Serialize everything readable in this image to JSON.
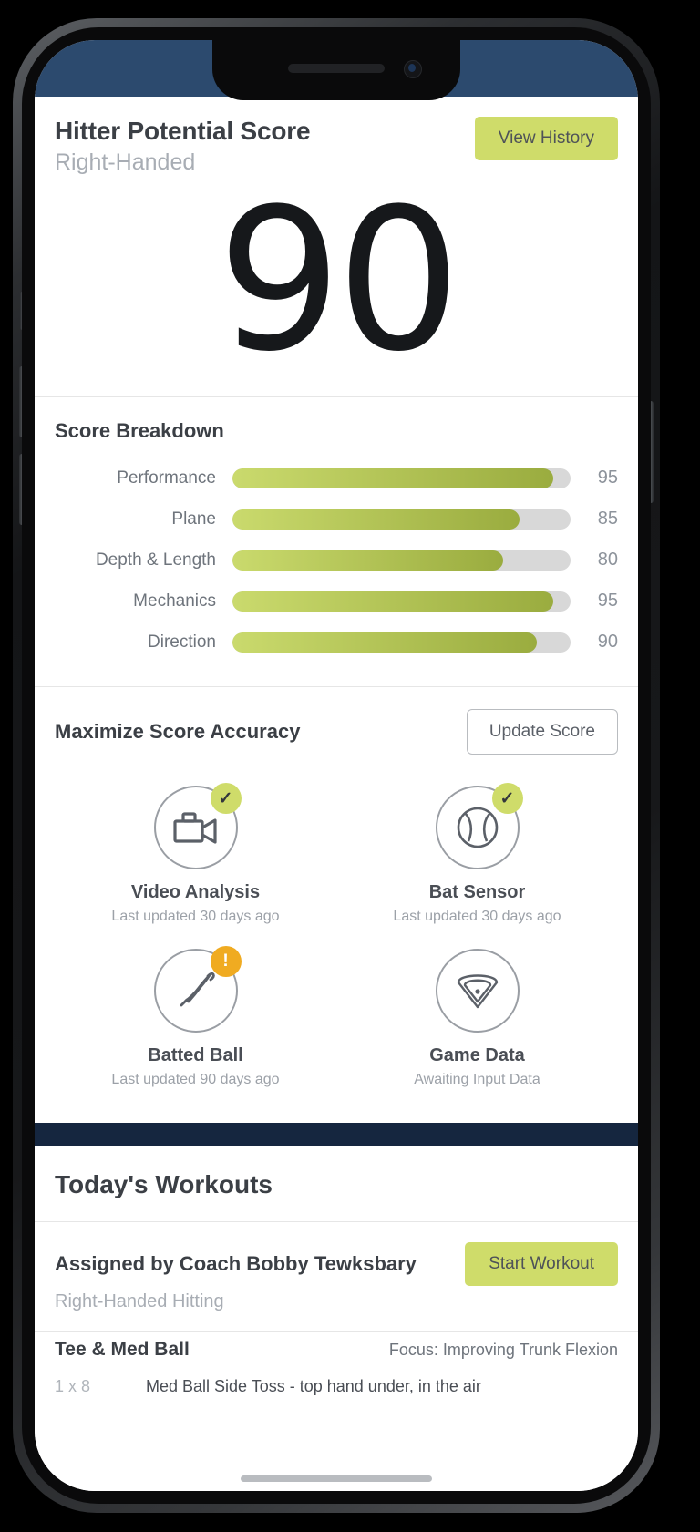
{
  "header": {
    "title": "Hitter Potential Score",
    "subtitle": "Right-Handed",
    "view_history_label": "View History"
  },
  "score": {
    "value": "90"
  },
  "breakdown": {
    "title": "Score Breakdown",
    "rows": [
      {
        "label": "Performance",
        "value": "95",
        "pct": 95
      },
      {
        "label": "Plane",
        "value": "85",
        "pct": 85
      },
      {
        "label": "Depth & Length",
        "value": "80",
        "pct": 80
      },
      {
        "label": "Mechanics",
        "value": "95",
        "pct": 95
      },
      {
        "label": "Direction",
        "value": "90",
        "pct": 90
      }
    ]
  },
  "maximize": {
    "title": "Maximize Score Accuracy",
    "update_label": "Update Score",
    "sources": [
      {
        "name": "Video Analysis",
        "status": "Last updated 30 days ago",
        "icon": "video-camera-icon",
        "badge": "check"
      },
      {
        "name": "Bat Sensor",
        "status": "Last updated 30 days ago",
        "icon": "baseball-icon",
        "badge": "check"
      },
      {
        "name": "Batted Ball",
        "status": "Last updated 90 days ago",
        "icon": "bat-icon",
        "badge": "warning"
      },
      {
        "name": "Game Data",
        "status": "Awaiting Input Data",
        "icon": "field-diamond-icon",
        "badge": "none"
      }
    ]
  },
  "workouts": {
    "title": "Today's Workouts",
    "assigned_by": "Assigned by Coach Bobby Tewksbary",
    "assigned_sub": "Right-Handed Hitting",
    "start_label": "Start Workout",
    "block_name": "Tee & Med Ball",
    "block_focus": "Focus: Improving Trunk Flexion",
    "exercise_reps": "1 x 8",
    "exercise_desc": "Med Ball Side Toss - top hand under, in the air"
  },
  "colors": {
    "accent_green": "#cfdc6a",
    "bar_start": "#cada6d",
    "bar_end": "#9aac3f",
    "navy": "#15263f",
    "statusbar_navy": "#2c4a6e",
    "warning_orange": "#f0ab21"
  },
  "badge_glyphs": {
    "check": "✓",
    "warning": "!"
  }
}
